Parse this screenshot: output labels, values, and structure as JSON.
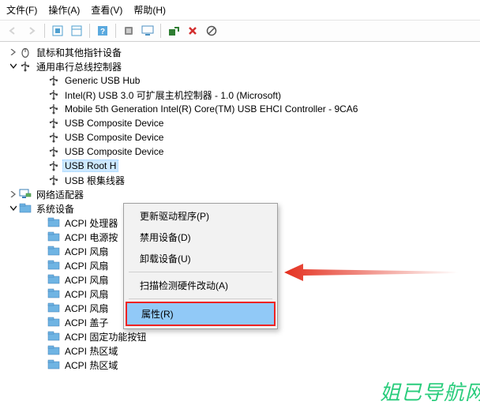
{
  "menu": {
    "file": "文件(F)",
    "action": "操作(A)",
    "view": "查看(V)",
    "help": "帮助(H)"
  },
  "tree": {
    "mouse_category": "鼠标和其他指针设备",
    "usb_category": "通用串行总线控制器",
    "usb_children": [
      "Generic USB Hub",
      "Intel(R) USB 3.0 可扩展主机控制器 - 1.0 (Microsoft)",
      "Mobile 5th Generation Intel(R) Core(TM) USB EHCI Controller - 9CA6",
      "USB Composite Device",
      "USB Composite Device",
      "USB Composite Device",
      "USB Root Hub",
      "USB 根集线器"
    ],
    "usb_selected_display": "USB Root H",
    "network_category": "网络适配器",
    "system_category": "系统设备",
    "system_children": [
      "ACPI 处理器",
      "ACPI 电源按",
      "ACPI 风扇",
      "ACPI 风扇",
      "ACPI 风扇",
      "ACPI 风扇",
      "ACPI 风扇",
      "ACPI 盖子",
      "ACPI 固定功能按钮",
      "ACPI 热区域",
      "ACPI 热区域"
    ]
  },
  "context_menu": {
    "update_driver": "更新驱动程序(P)",
    "disable": "禁用设备(D)",
    "uninstall": "卸载设备(U)",
    "scan": "扫描检测硬件改动(A)",
    "properties": "属性(R)"
  },
  "watermark": "姐已导航网"
}
